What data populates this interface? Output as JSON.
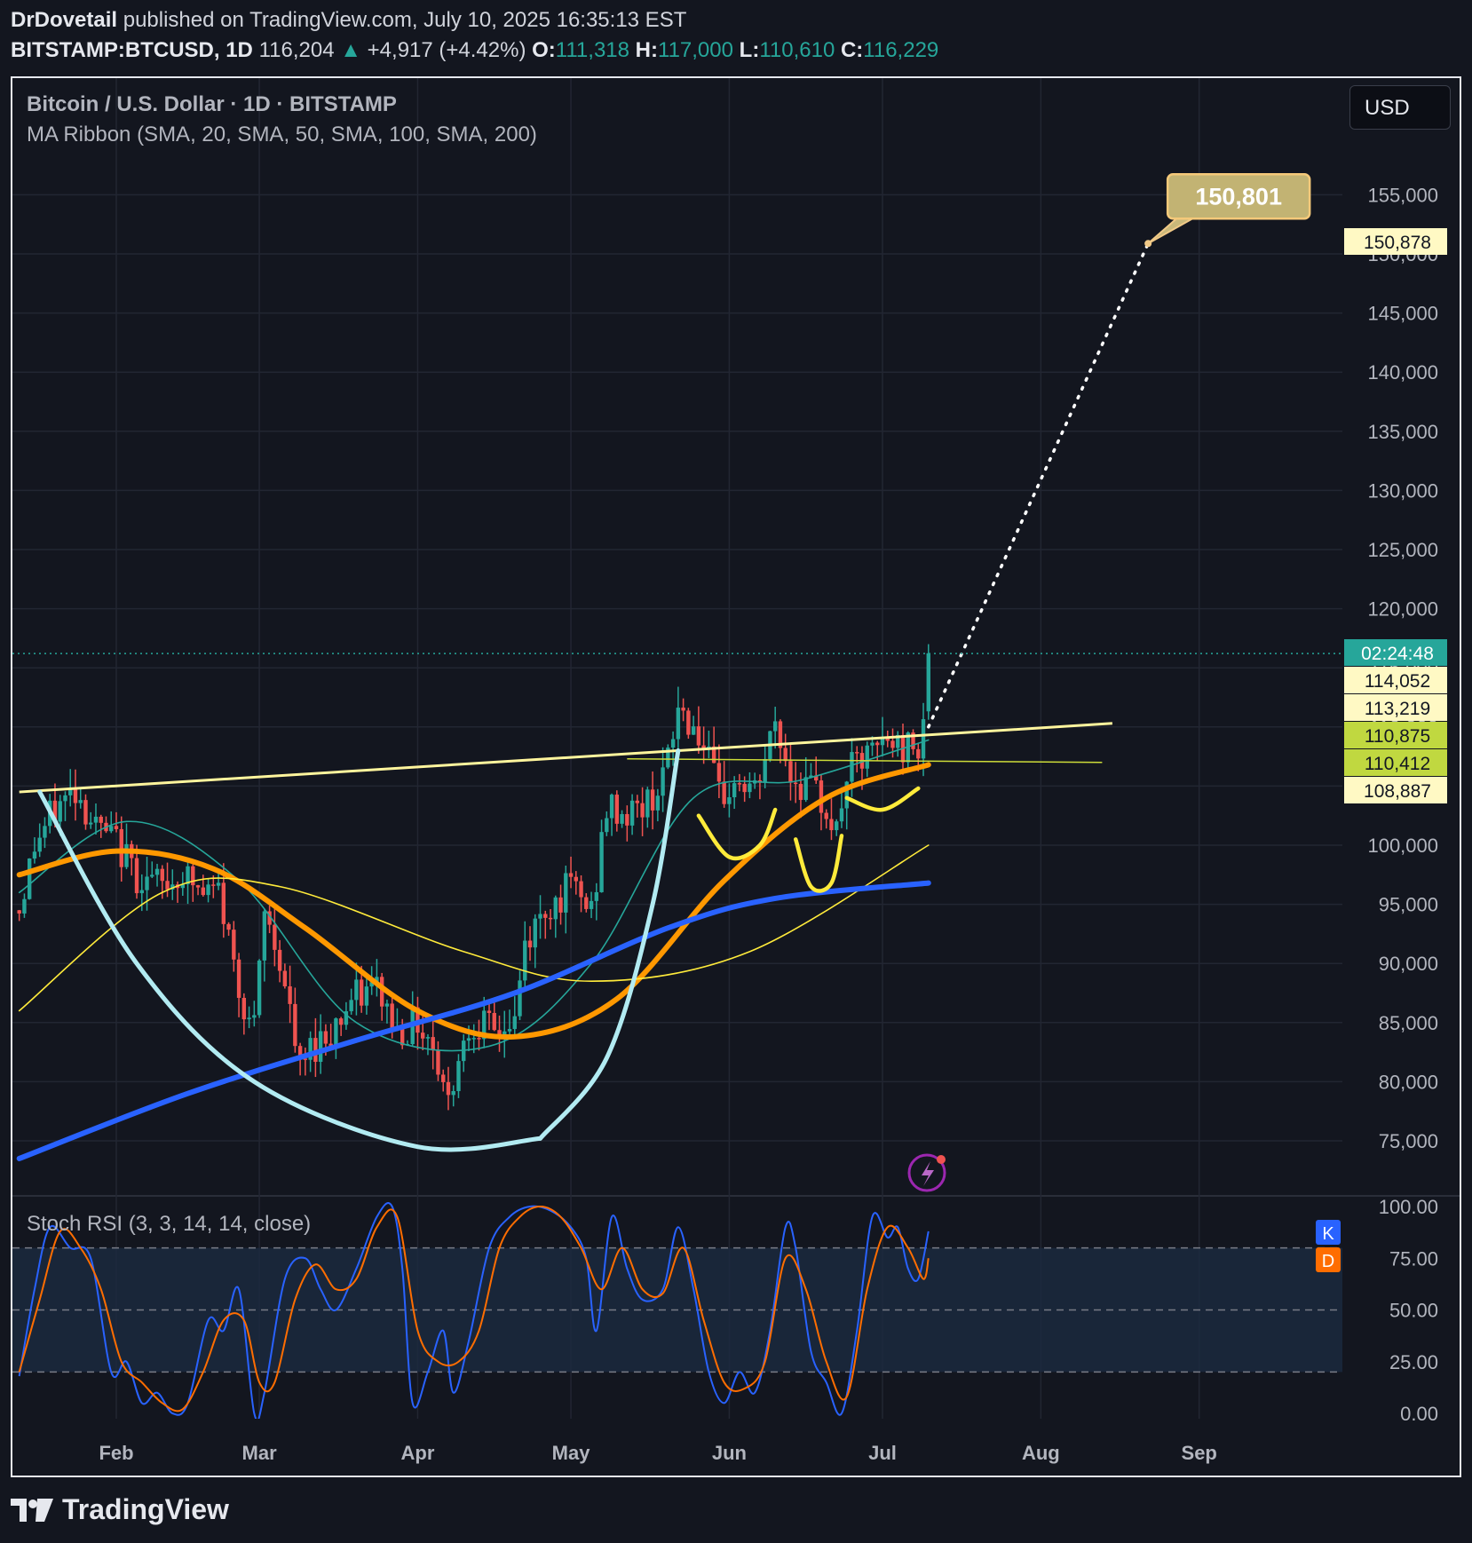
{
  "header": {
    "author": "DrDovetail",
    "published_text": "published on TradingView.com, July 10, 2025 16:35:13 EST",
    "symbol": "BITSTAMP:BTCUSD, 1D",
    "last": "116,204",
    "change": "+4,917 (+4.42%)",
    "o_label": "O:",
    "o_value": "111,318",
    "h_label": "H:",
    "h_value": "117,000",
    "l_label": "L:",
    "l_value": "110,610",
    "c_label": "C:",
    "c_value": "116,229"
  },
  "legend": {
    "title": "Bitcoin / U.S. Dollar · 1D · BITSTAMP",
    "indicator": "MA Ribbon (SMA, 20, SMA, 50, SMA, 100, SMA, 200)",
    "stoch": "Stoch RSI (3, 3, 14, 14, close)"
  },
  "currency_button": "USD",
  "target_label": "150,801",
  "footer": {
    "brand": "TradingView"
  },
  "colors": {
    "background": "#13161f",
    "up": "#26a69a",
    "down": "#ef5350",
    "sma20": "#26a69a",
    "sma50": "#ff9800",
    "sma100": "#ffeb3b",
    "sma200": "#2962ff",
    "stoch_k": "#2962ff",
    "stoch_d": "#ff6d00",
    "trendline": "#fff59d",
    "cup": "#b2ebf2"
  },
  "chart_data": [
    {
      "type": "candlestick",
      "title": "Bitcoin / U.S. Dollar · 1D · BITSTAMP",
      "x_axis": {
        "ticks": [
          "Feb",
          "Mar",
          "Apr",
          "May",
          "Jun",
          "Jul",
          "Aug",
          "Sep"
        ],
        "range": [
          "2025-01-13",
          "2025-09-25"
        ]
      },
      "y_axis": {
        "ticks": [
          75000,
          80000,
          85000,
          90000,
          95000,
          100000,
          105000,
          110000,
          115000,
          120000,
          125000,
          130000,
          135000,
          140000,
          145000,
          150000,
          155000
        ],
        "range": [
          72000,
          168000
        ],
        "side": "right"
      },
      "grid": true,
      "price_labels": [
        {
          "text": "150,878",
          "value": 150878
        },
        {
          "text": "02:24:48",
          "value": 116204
        },
        {
          "text": "114,052",
          "value": 114052
        },
        {
          "text": "113,219",
          "value": 113219
        },
        {
          "text": "110,875",
          "value": 110875
        },
        {
          "text": "110,412",
          "value": 110412
        },
        {
          "text": "108,887",
          "value": 108887
        }
      ],
      "close_series": [
        {
          "date": "2025-01-13",
          "close": 94500
        },
        {
          "date": "2025-01-16",
          "close": 100000
        },
        {
          "date": "2025-01-20",
          "close": 103000
        },
        {
          "date": "2025-01-24",
          "close": 104800
        },
        {
          "date": "2025-01-28",
          "close": 101500
        },
        {
          "date": "2025-02-01",
          "close": 100200
        },
        {
          "date": "2025-02-05",
          "close": 97500
        },
        {
          "date": "2025-02-10",
          "close": 96500
        },
        {
          "date": "2025-02-14",
          "close": 97600
        },
        {
          "date": "2025-02-18",
          "close": 95700
        },
        {
          "date": "2025-02-21",
          "close": 96200
        },
        {
          "date": "2025-02-25",
          "close": 88000
        },
        {
          "date": "2025-02-28",
          "close": 84300
        },
        {
          "date": "2025-03-02",
          "close": 94200
        },
        {
          "date": "2025-03-05",
          "close": 90500
        },
        {
          "date": "2025-03-09",
          "close": 80700
        },
        {
          "date": "2025-03-11",
          "close": 82900
        },
        {
          "date": "2025-03-15",
          "close": 84300
        },
        {
          "date": "2025-03-19",
          "close": 86800
        },
        {
          "date": "2025-03-24",
          "close": 88000
        },
        {
          "date": "2025-03-28",
          "close": 84300
        },
        {
          "date": "2025-04-01",
          "close": 85100
        },
        {
          "date": "2025-04-04",
          "close": 83200
        },
        {
          "date": "2025-04-07",
          "close": 78300
        },
        {
          "date": "2025-04-09",
          "close": 82500
        },
        {
          "date": "2025-04-12",
          "close": 85300
        },
        {
          "date": "2025-04-16",
          "close": 84000
        },
        {
          "date": "2025-04-20",
          "close": 85100
        },
        {
          "date": "2025-04-22",
          "close": 91500
        },
        {
          "date": "2025-04-26",
          "close": 94600
        },
        {
          "date": "2025-05-01",
          "close": 96500
        },
        {
          "date": "2025-05-05",
          "close": 94300
        },
        {
          "date": "2025-05-08",
          "close": 103000
        },
        {
          "date": "2025-05-12",
          "close": 102600
        },
        {
          "date": "2025-05-16",
          "close": 103500
        },
        {
          "date": "2025-05-20",
          "close": 106800
        },
        {
          "date": "2025-05-22",
          "close": 111700
        },
        {
          "date": "2025-05-26",
          "close": 109500
        },
        {
          "date": "2025-05-30",
          "close": 104000
        },
        {
          "date": "2025-06-03",
          "close": 105400
        },
        {
          "date": "2025-06-06",
          "close": 104300
        },
        {
          "date": "2025-06-10",
          "close": 110200
        },
        {
          "date": "2025-06-13",
          "close": 105900
        },
        {
          "date": "2025-06-17",
          "close": 104600
        },
        {
          "date": "2025-06-20",
          "close": 103300
        },
        {
          "date": "2025-06-22",
          "close": 100900
        },
        {
          "date": "2025-06-24",
          "close": 106000
        },
        {
          "date": "2025-06-28",
          "close": 107300
        },
        {
          "date": "2025-07-02",
          "close": 108900
        },
        {
          "date": "2025-07-05",
          "close": 108200
        },
        {
          "date": "2025-07-08",
          "close": 108900
        },
        {
          "date": "2025-07-09",
          "close": 111300
        },
        {
          "date": "2025-07-10",
          "close": 116229
        }
      ],
      "series": [
        {
          "name": "SMA 20",
          "points": [
            [
              "2025-01-13",
              96000
            ],
            [
              "2025-02-03",
              102000
            ],
            [
              "2025-02-25",
              97000
            ],
            [
              "2025-03-20",
              85000
            ],
            [
              "2025-04-15",
              83000
            ],
            [
              "2025-05-05",
              90000
            ],
            [
              "2025-05-25",
              104000
            ],
            [
              "2025-06-15",
              105500
            ],
            [
              "2025-07-10",
              108900
            ]
          ]
        },
        {
          "name": "SMA 50",
          "points": [
            [
              "2025-01-13",
              97500
            ],
            [
              "2025-02-01",
              99500
            ],
            [
              "2025-02-20",
              98000
            ],
            [
              "2025-03-10",
              93000
            ],
            [
              "2025-04-01",
              86000
            ],
            [
              "2025-04-20",
              83800
            ],
            [
              "2025-05-10",
              87000
            ],
            [
              "2025-05-31",
              97000
            ],
            [
              "2025-06-20",
              104000
            ],
            [
              "2025-07-10",
              106800
            ]
          ]
        },
        {
          "name": "SMA 100",
          "points": [
            [
              "2025-01-13",
              86000
            ],
            [
              "2025-02-10",
              96000
            ],
            [
              "2025-03-05",
              96500
            ],
            [
              "2025-04-10",
              91000
            ],
            [
              "2025-05-05",
              88500
            ],
            [
              "2025-06-05",
              91000
            ],
            [
              "2025-07-10",
              100000
            ]
          ]
        },
        {
          "name": "SMA 200",
          "points": [
            [
              "2025-01-13",
              73500
            ],
            [
              "2025-02-15",
              79000
            ],
            [
              "2025-03-20",
              83500
            ],
            [
              "2025-04-20",
              87500
            ],
            [
              "2025-05-20",
              93000
            ],
            [
              "2025-06-10",
              95500
            ],
            [
              "2025-07-10",
              96800
            ]
          ]
        }
      ],
      "annotations": [
        {
          "type": "trendline",
          "from": [
            "2025-01-13",
            104500
          ],
          "to": [
            "2025-08-15",
            110300
          ]
        },
        {
          "type": "horizontal",
          "from": [
            "2025-05-12",
            107300
          ],
          "to": [
            "2025-08-13",
            107000
          ]
        },
        {
          "type": "projection",
          "from": [
            "2025-07-10",
            110000
          ],
          "to": [
            "2025-08-22",
            150878
          ]
        },
        {
          "type": "target_callout",
          "text": "150,801",
          "value": 150801
        }
      ]
    },
    {
      "type": "line",
      "title": "Stoch RSI (3, 3, 14, 14, close)",
      "y_axis": {
        "ticks": [
          0,
          25,
          50,
          75,
          100
        ],
        "range": [
          0,
          100
        ]
      },
      "bands": [
        20,
        50,
        80
      ],
      "badges": [
        "K",
        "D"
      ],
      "series": [
        {
          "name": "K",
          "points": [
            [
              "2025-01-13",
              18
            ],
            [
              "2025-01-16",
              60
            ],
            [
              "2025-01-19",
              90
            ],
            [
              "2025-01-23",
              80
            ],
            [
              "2025-01-27",
              75
            ],
            [
              "2025-01-31",
              20
            ],
            [
              "2025-02-03",
              25
            ],
            [
              "2025-02-06",
              5
            ],
            [
              "2025-02-09",
              10
            ],
            [
              "2025-02-12",
              0
            ],
            [
              "2025-02-15",
              5
            ],
            [
              "2025-02-19",
              45
            ],
            [
              "2025-02-22",
              40
            ],
            [
              "2025-02-25",
              60
            ],
            [
              "2025-02-28",
              0
            ],
            [
              "2025-03-02",
              10
            ],
            [
              "2025-03-06",
              65
            ],
            [
              "2025-03-10",
              75
            ],
            [
              "2025-03-13",
              60
            ],
            [
              "2025-03-16",
              50
            ],
            [
              "2025-03-20",
              70
            ],
            [
              "2025-03-24",
              95
            ],
            [
              "2025-03-27",
              100
            ],
            [
              "2025-03-29",
              70
            ],
            [
              "2025-03-31",
              5
            ],
            [
              "2025-04-03",
              20
            ],
            [
              "2025-04-06",
              40
            ],
            [
              "2025-04-08",
              10
            ],
            [
              "2025-04-11",
              35
            ],
            [
              "2025-04-15",
              80
            ],
            [
              "2025-04-19",
              95
            ],
            [
              "2025-04-23",
              100
            ],
            [
              "2025-04-27",
              98
            ],
            [
              "2025-05-01",
              90
            ],
            [
              "2025-05-04",
              75
            ],
            [
              "2025-05-06",
              40
            ],
            [
              "2025-05-09",
              95
            ],
            [
              "2025-05-12",
              70
            ],
            [
              "2025-05-15",
              55
            ],
            [
              "2025-05-19",
              60
            ],
            [
              "2025-05-22",
              90
            ],
            [
              "2025-05-25",
              60
            ],
            [
              "2025-05-28",
              20
            ],
            [
              "2025-05-31",
              5
            ],
            [
              "2025-06-03",
              20
            ],
            [
              "2025-06-06",
              10
            ],
            [
              "2025-06-09",
              40
            ],
            [
              "2025-06-12",
              90
            ],
            [
              "2025-06-14",
              80
            ],
            [
              "2025-06-17",
              30
            ],
            [
              "2025-06-20",
              15
            ],
            [
              "2025-06-23",
              0
            ],
            [
              "2025-06-26",
              40
            ],
            [
              "2025-06-29",
              95
            ],
            [
              "2025-07-02",
              85
            ],
            [
              "2025-07-04",
              90
            ],
            [
              "2025-07-06",
              70
            ],
            [
              "2025-07-08",
              65
            ],
            [
              "2025-07-10",
              88
            ]
          ]
        },
        {
          "name": "D",
          "points": [
            [
              "2025-01-13",
              20
            ],
            [
              "2025-01-17",
              55
            ],
            [
              "2025-01-21",
              88
            ],
            [
              "2025-01-25",
              80
            ],
            [
              "2025-01-29",
              60
            ],
            [
              "2025-02-02",
              25
            ],
            [
              "2025-02-06",
              15
            ],
            [
              "2025-02-10",
              5
            ],
            [
              "2025-02-14",
              2
            ],
            [
              "2025-02-18",
              20
            ],
            [
              "2025-02-22",
              45
            ],
            [
              "2025-02-26",
              45
            ],
            [
              "2025-03-01",
              15
            ],
            [
              "2025-03-04",
              15
            ],
            [
              "2025-03-08",
              55
            ],
            [
              "2025-03-12",
              72
            ],
            [
              "2025-03-16",
              60
            ],
            [
              "2025-03-20",
              65
            ],
            [
              "2025-03-24",
              90
            ],
            [
              "2025-03-28",
              95
            ],
            [
              "2025-04-01",
              40
            ],
            [
              "2025-04-05",
              25
            ],
            [
              "2025-04-09",
              25
            ],
            [
              "2025-04-13",
              40
            ],
            [
              "2025-04-17",
              80
            ],
            [
              "2025-04-21",
              95
            ],
            [
              "2025-04-25",
              100
            ],
            [
              "2025-04-29",
              95
            ],
            [
              "2025-05-03",
              80
            ],
            [
              "2025-05-07",
              60
            ],
            [
              "2025-05-11",
              80
            ],
            [
              "2025-05-15",
              60
            ],
            [
              "2025-05-19",
              58
            ],
            [
              "2025-05-23",
              80
            ],
            [
              "2025-05-27",
              45
            ],
            [
              "2025-05-31",
              15
            ],
            [
              "2025-06-04",
              12
            ],
            [
              "2025-06-08",
              25
            ],
            [
              "2025-06-12",
              75
            ],
            [
              "2025-06-16",
              60
            ],
            [
              "2025-06-20",
              25
            ],
            [
              "2025-06-24",
              8
            ],
            [
              "2025-06-28",
              60
            ],
            [
              "2025-07-02",
              90
            ],
            [
              "2025-07-06",
              80
            ],
            [
              "2025-07-09",
              65
            ],
            [
              "2025-07-10",
              75
            ]
          ]
        }
      ]
    }
  ]
}
